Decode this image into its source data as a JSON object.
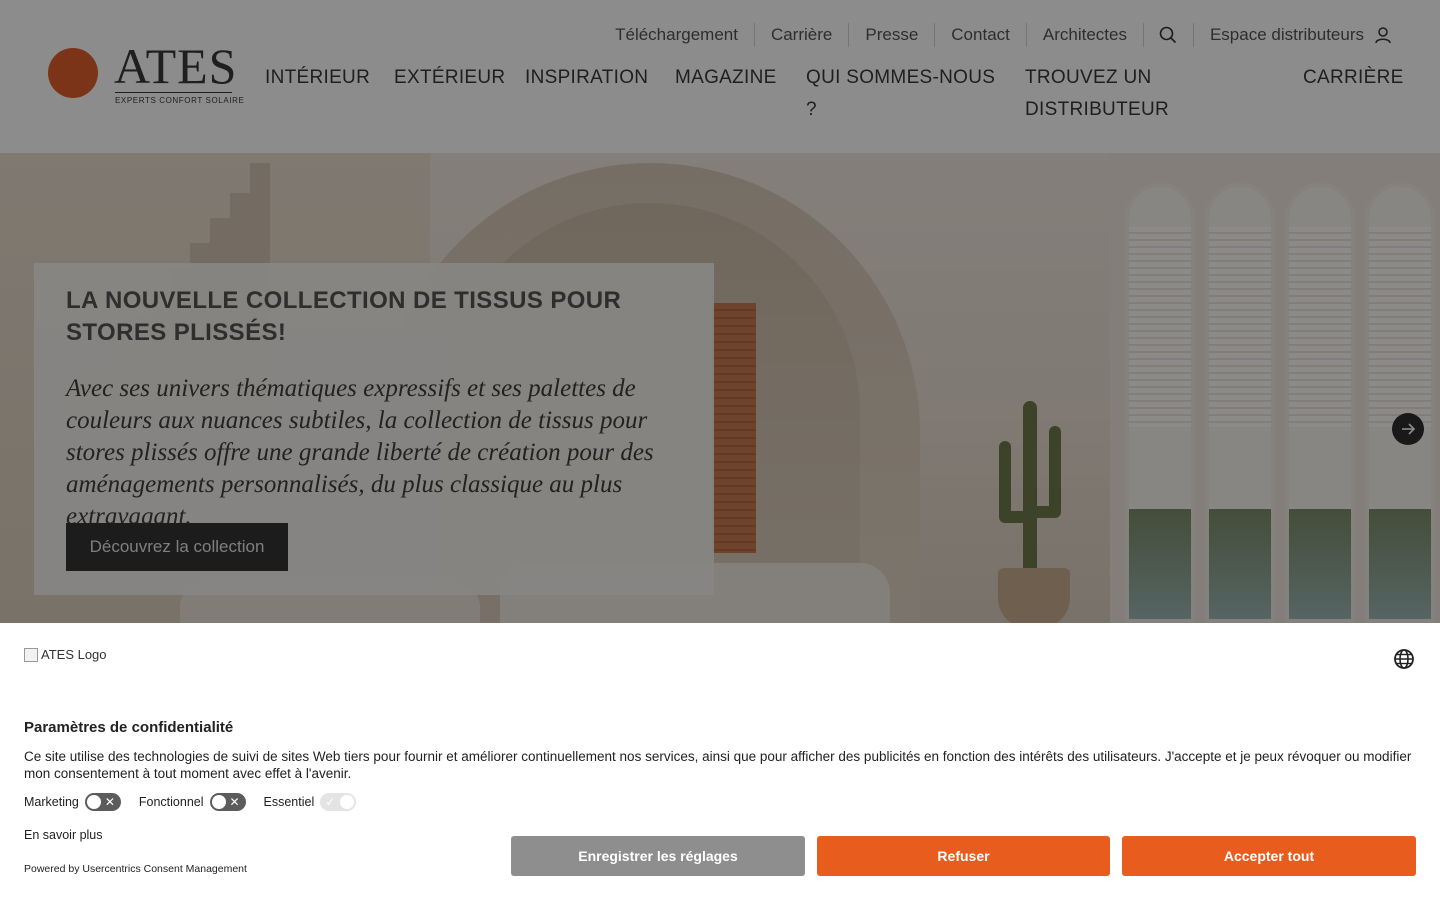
{
  "header": {
    "logo": {
      "name": "ATES",
      "tagline": "EXPERTS CONFORT SOLAIRE"
    },
    "top_links": [
      "Téléchargement",
      "Carrière",
      "Presse",
      "Contact",
      "Architectes"
    ],
    "search_icon": "search-icon",
    "distributor_link": "Espace distributeurs",
    "user_icon": "user-icon",
    "nav": [
      "INTÉRIEUR",
      "EXTÉRIEUR",
      "INSPIRATION",
      "MAGAZINE",
      "QUI SOMMES-NOUS ?",
      "TROUVEZ UN DISTRIBUTEUR",
      "CARRIÈRE"
    ]
  },
  "hero": {
    "title": "LA NOUVELLE COLLECTION DE TISSUS POUR STORES PLISSÉS!",
    "text": "Avec ses univers thématiques expressifs et ses palettes de couleurs aux nuances subtiles, la collection de tissus pour stores plissés offre une grande liberté de création pour des aménagements personnalisés, du plus classique au plus extravagant.",
    "button": "Découvrez la collection",
    "next_icon": "arrow-right-icon"
  },
  "consent": {
    "logo_alt": "ATES Logo",
    "language_icon": "globe-icon",
    "title": "Paramètres de confidentialité",
    "text": "Ce site utilise des technologies de suivi de sites Web tiers pour fournir et améliorer continuellement nos services, ainsi que pour afficher des publicités en fonction des intérêts des utilisateurs. J'accepte et je peux révoquer ou modifier mon consentement à tout moment avec effet à l'avenir.",
    "toggles": [
      {
        "label": "Marketing",
        "on": false
      },
      {
        "label": "Fonctionnel",
        "on": false
      },
      {
        "label": "Essentiel",
        "on": true,
        "disabled": true
      }
    ],
    "learn_more": "En savoir plus",
    "powered_by": "Powered by Usercentrics Consent Management",
    "buttons": {
      "save": "Enregistrer les réglages",
      "refuse": "Refuser",
      "accept": "Accepter tout"
    },
    "colors": {
      "accent": "#e85c1e",
      "save": "#8e8e8e"
    }
  }
}
